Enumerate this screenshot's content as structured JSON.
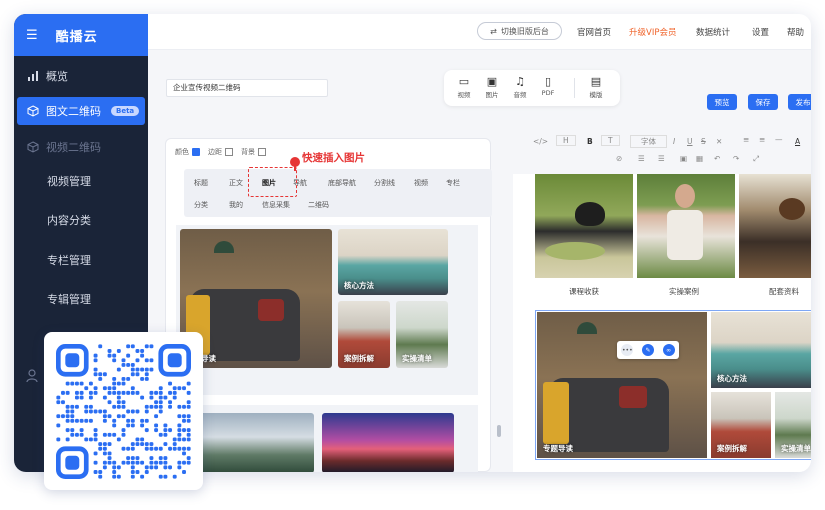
{
  "brand": {
    "name": "酷播云",
    "menu_icon": "hamburger-icon"
  },
  "sidebar": {
    "items": [
      {
        "label": "概览",
        "icon": "bar-chart-icon"
      },
      {
        "label": "图文二维码",
        "icon": "cube-icon",
        "badge": "Beta"
      },
      {
        "label": "视频二维码",
        "icon": "cube-icon"
      },
      {
        "label": "视频管理"
      },
      {
        "label": "内容分类"
      },
      {
        "label": "专栏管理"
      },
      {
        "label": "专辑管理"
      }
    ]
  },
  "topbar": {
    "switch_label": "切换旧版后台",
    "links": [
      "官网首页",
      "升级VIP会员",
      "数据统计",
      "设置",
      "帮助"
    ]
  },
  "editor": {
    "title_value": "企业宣传视频二维码",
    "insert": [
      {
        "label": "视频",
        "icon": "video-icon"
      },
      {
        "label": "图片",
        "icon": "image-icon"
      },
      {
        "label": "音频",
        "icon": "music-icon"
      },
      {
        "label": "PDF",
        "icon": "file-icon"
      },
      {
        "label": "模版",
        "icon": "template-icon"
      }
    ],
    "actions": [
      "预览",
      "保存",
      "发布"
    ],
    "style_labels": [
      "颜色",
      "边距",
      "背景"
    ],
    "tabs_row1": [
      "标题",
      "正文",
      "图片",
      "导航",
      "底部导航",
      "分割线",
      "视频",
      "专栏"
    ],
    "tabs_row2": [
      "分类",
      "我的",
      "信息采集",
      "二维码"
    ],
    "callout": "快速插入图片",
    "grid_labels": [
      "专题导读",
      "核心方法",
      "案例拆解",
      "实操清单"
    ]
  },
  "format_bar": {
    "row1": [
      "</>",
      "H",
      "B",
      "T",
      "字体",
      "I",
      "U",
      "S",
      "A"
    ],
    "row2": [
      "link",
      "list-ol",
      "list-ul",
      "image",
      "undo",
      "redo",
      "fullscreen"
    ]
  },
  "preview": {
    "captions": [
      "课程收获",
      "实操案例",
      "配套资料"
    ],
    "grid_labels": [
      "专题导读",
      "核心方法",
      "案例拆解",
      "实操清单"
    ]
  },
  "colors": {
    "accent": "#2b6ef2",
    "sidebar": "#1a2438",
    "callout": "#e63535",
    "vip": "#f0642b"
  }
}
